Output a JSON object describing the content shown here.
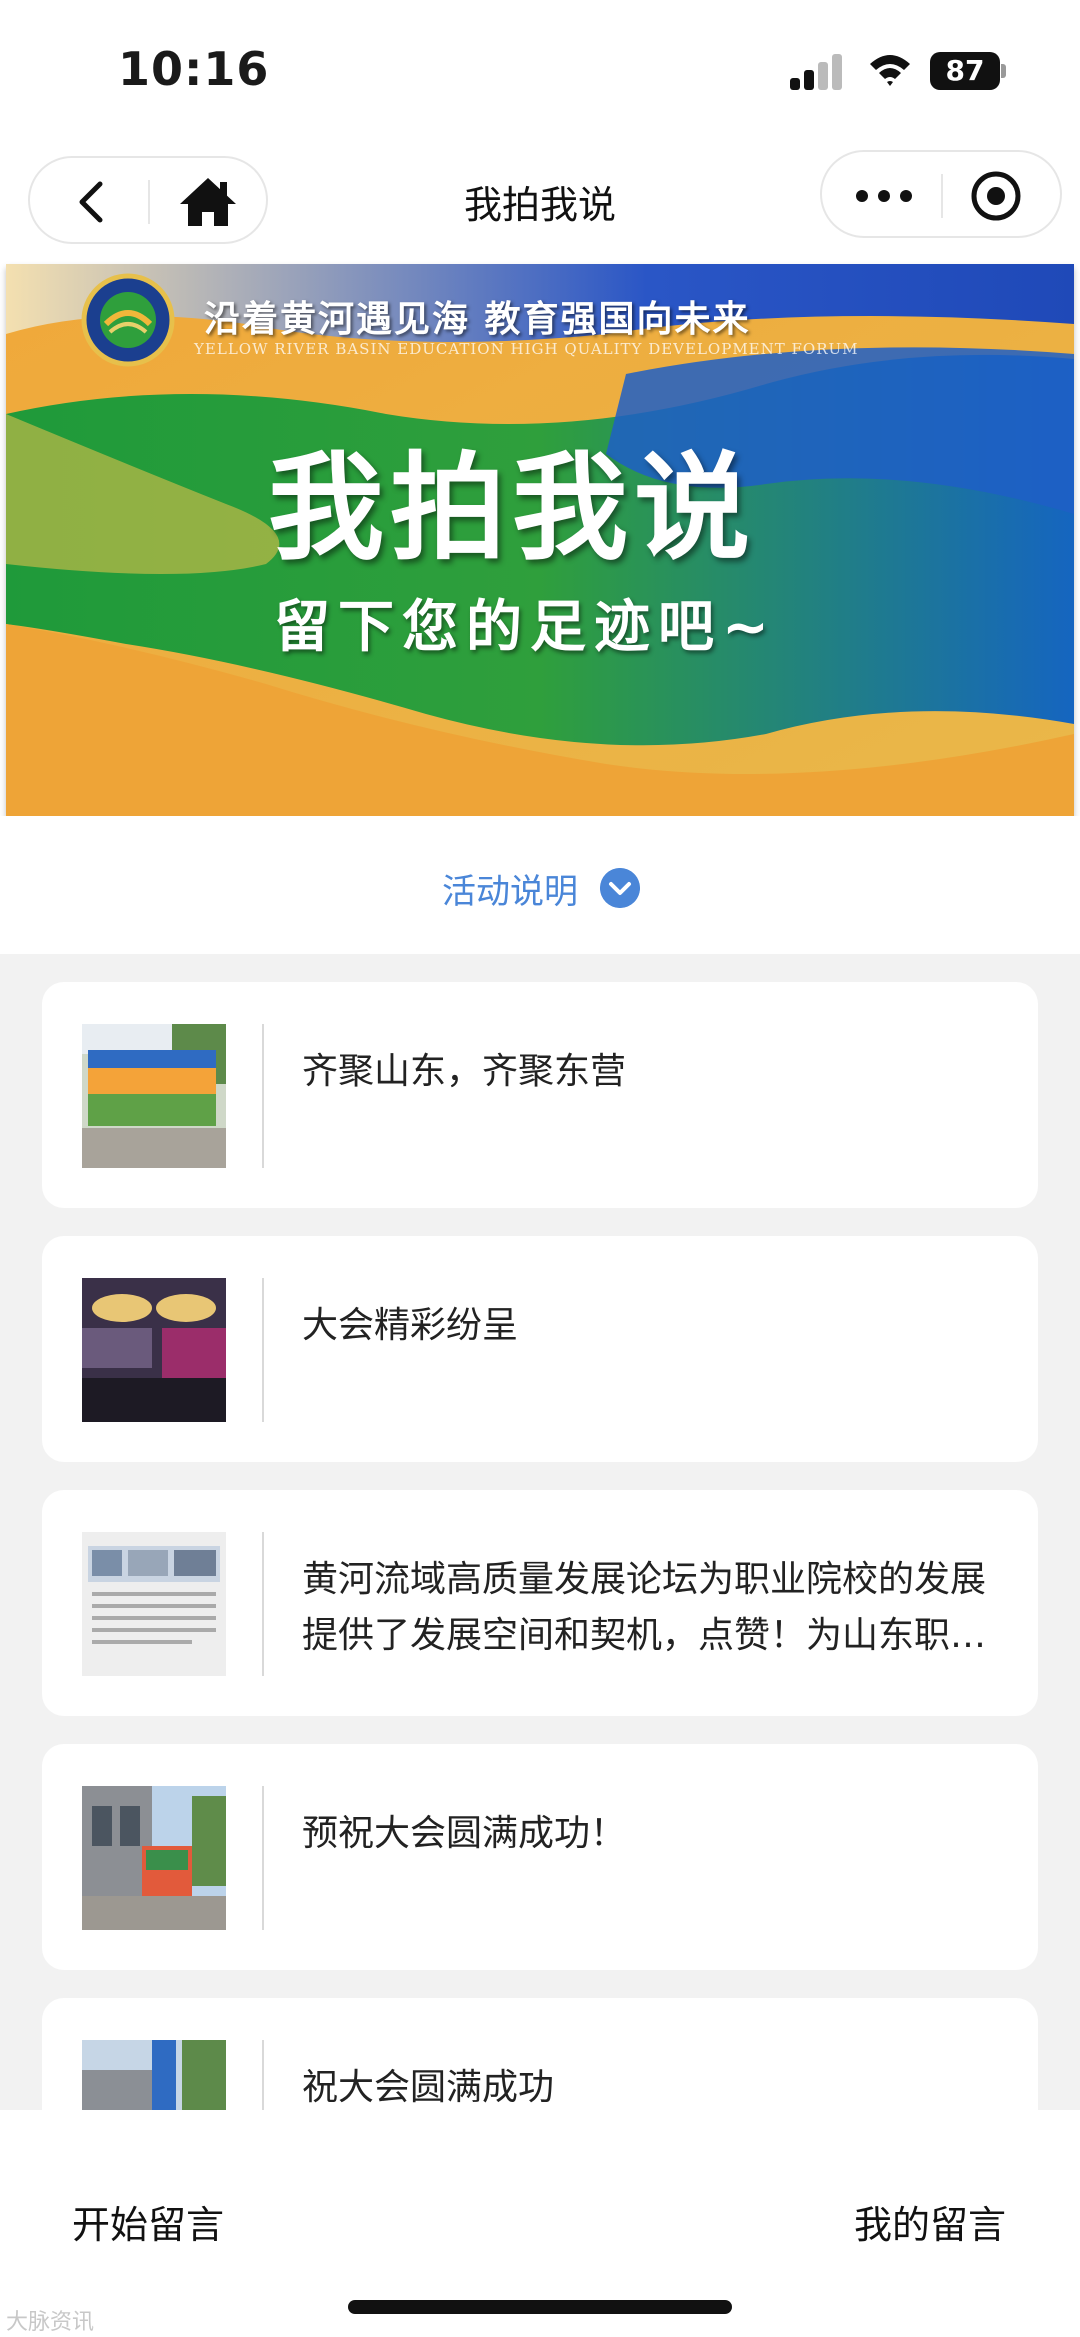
{
  "status_bar": {
    "time": "10:16",
    "battery": "87"
  },
  "nav": {
    "title": "我拍我说"
  },
  "banner": {
    "slogan": "沿着黄河遇见海  教育强国向未来",
    "slogan_en": "YELLOW RIVER BASIN EDUCATION HIGH QUALITY DEVELOPMENT FORUM",
    "title": "我拍我说",
    "subtitle": "留下您的足迹吧~"
  },
  "activity": {
    "label": "活动说明"
  },
  "posts": [
    {
      "text": "齐聚山东，齐聚东营",
      "thumb": "event-sign-photo"
    },
    {
      "text": "大会精彩纷呈",
      "thumb": "conference-hall-photo"
    },
    {
      "text": "黄河流域高质量发展论坛为职业院校的发展提供了发展空间和契机，点赞！为山东职业教育点赞！",
      "thumb": "exhibition-board-photo"
    },
    {
      "text": "预祝大会圆满成功！",
      "thumb": "building-entrance-photo"
    },
    {
      "text": "祝大会圆满成功",
      "thumb": "outdoor-banner-photo"
    }
  ],
  "bottom": {
    "start_label": "开始留言",
    "mine_label": "我的留言",
    "watermark": "大脉资讯"
  },
  "colors": {
    "accent": "#4a86d8",
    "list_bg": "#f2f2f2"
  }
}
